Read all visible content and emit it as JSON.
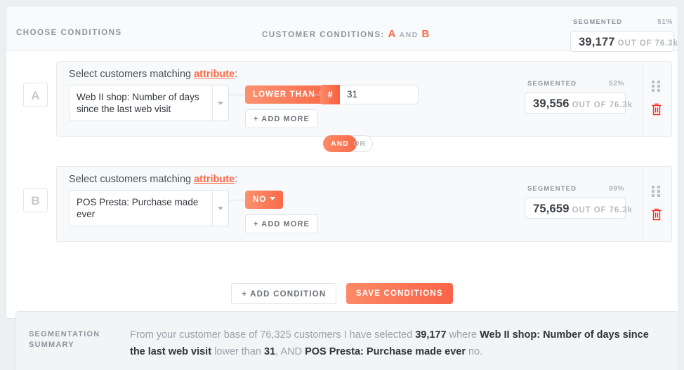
{
  "header": {
    "choose_conditions": "CHOOSE CONDITIONS",
    "customer_conditions_label": "CUSTOMER CONDITIONS:",
    "condition_a_letter": "A",
    "and_word": "AND",
    "condition_b_letter": "B",
    "segmented": {
      "label": "SEGMENTED",
      "percent": "51%",
      "count": "39,177",
      "out_of": "OUT OF 76.3k"
    }
  },
  "conditions": [
    {
      "letter": "A",
      "prompt_prefix": "Select customers matching ",
      "prompt_link": "attribute",
      "prompt_suffix": ":",
      "attribute": "Web II shop: Number of days since the last web visit",
      "operator": "LOWER THAN",
      "value_badge": "#",
      "value": "31",
      "add_more": "+ ADD MORE",
      "segmented": {
        "label": "SEGMENTED",
        "percent": "52%",
        "count": "39,556",
        "out_of": "OUT OF 76.3k"
      }
    },
    {
      "letter": "B",
      "prompt_prefix": "Select customers matching ",
      "prompt_link": "attribute",
      "prompt_suffix": ":",
      "attribute": "POS Presta: Purchase made ever",
      "operator": "NO",
      "add_more": "+ ADD MORE",
      "segmented": {
        "label": "SEGMENTED",
        "percent": "99%",
        "count": "75,659",
        "out_of": "OUT OF 76.3k"
      }
    }
  ],
  "logic_toggle": {
    "and_label": "AND",
    "or_label": "OR",
    "selected": "AND"
  },
  "footer": {
    "add_condition": "+ ADD CONDITION",
    "save_conditions": "SAVE CONDITIONS"
  },
  "summary": {
    "label": "SEGMENTATION SUMMARY",
    "part1": "From your customer base of 76,325 customers I have selected ",
    "selected_count": "39,177",
    "part2": " where ",
    "attr_a": "Web II shop: Number of days since the last web visit",
    "part3": " lower than ",
    "value_a": "31",
    "part4": ", AND ",
    "attr_b": "POS Presta: Purchase made ever",
    "part5": " no."
  },
  "icons": {
    "drag_handle": "drag-handle-icon",
    "trash": "trash-icon",
    "caret_down": "chevron-down-icon"
  },
  "colors": {
    "accent": "#fa6a48",
    "accent_light": "#fb9170",
    "danger": "#f8281e",
    "muted": "#8c949d"
  }
}
